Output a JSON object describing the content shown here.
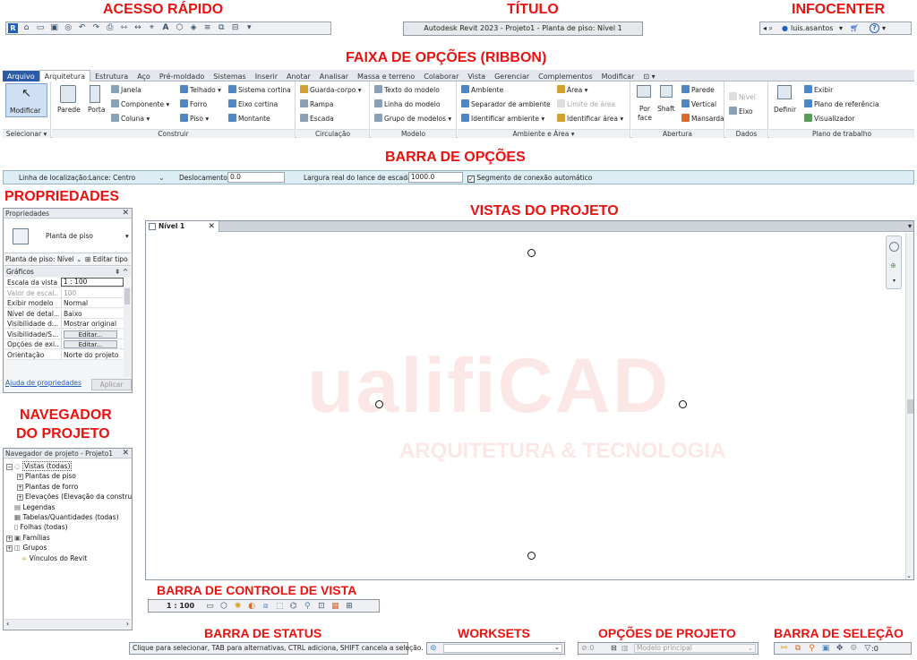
{
  "annotations": {
    "quick_access": "ACESSO RÁPIDO",
    "title": "TÍTULO",
    "infocenter": "INFOCENTER",
    "ribbon": "FAIXA DE OPÇÕES (RIBBON)",
    "options_bar": "BARRA DE OPÇÕES",
    "properties": "PROPRIEDADES",
    "project_views": "VISTAS DO PROJETO",
    "navigator_line1": "NAVEGADOR",
    "navigator_line2": "DO PROJETO",
    "view_control_bar": "BARRA DE CONTROLE DE VISTA",
    "status_bar": "BARRA DE STATUS",
    "worksets": "WORKSETS",
    "project_options": "OPÇÕES DE PROJETO",
    "selection_bar": "BARRA DE SELEÇÃO"
  },
  "window_title": "Autodesk Revit 2023 - Projeto1 - Planta de piso: Nível 1",
  "infocenter": {
    "user": "luis.asantos",
    "help": "?"
  },
  "tabs": [
    "Arquivo",
    "Arquitetura",
    "Estrutura",
    "Aço",
    "Pré-moldado",
    "Sistemas",
    "Inserir",
    "Anotar",
    "Analisar",
    "Massa e terreno",
    "Colaborar",
    "Vista",
    "Gerenciar",
    "Complementos",
    "Modificar"
  ],
  "ribbon": {
    "select": {
      "modify": "Modificar",
      "title": "Selecionar ▾"
    },
    "build": {
      "wall": "Parede",
      "door": "Porta",
      "window": "Janela",
      "component": "Componente",
      "column": "Coluna",
      "roof": "Telhado",
      "ceiling": "Forro",
      "floor": "Piso",
      "curtain_system": "Sistema cortina",
      "curtain_grid": "Eixo cortina",
      "mullion": "Montante",
      "title": "Construir"
    },
    "circulation": {
      "railing": "Guarda-corpo",
      "ramp": "Rampa",
      "stair": "Escada",
      "title": "Circulação"
    },
    "model": {
      "model_text": "Texto do modelo",
      "model_line": "Linha do modelo",
      "model_group": "Grupo de modelos",
      "title": "Modelo"
    },
    "room_area": {
      "room": "Ambiente",
      "room_separator": "Separador de ambiente",
      "tag_room": "Identificar ambiente",
      "area": "Área",
      "area_boundary": "Limite de área",
      "tag_area": "Identificar área",
      "title": "Ambiente e Área ▾"
    },
    "opening": {
      "by_face_1": "Por",
      "by_face_2": "face",
      "shaft": "Shaft",
      "wall": "Parede",
      "vertical": "Vertical",
      "dormer": "Mansarda",
      "title": "Abertura"
    },
    "datum": {
      "level": "Nível",
      "grid": "Eixo",
      "title": "Dados"
    },
    "work_plane": {
      "set": "Definir",
      "show": "Exibir",
      "ref_plane": "Plano de referência",
      "viewer": "Visualizador",
      "title": "Plano de trabalho"
    }
  },
  "options_bar": {
    "location_label": "Linha de localização:",
    "location_value": "Lance: Centro",
    "offset_label": "Deslocamento:",
    "offset_value": "0.0",
    "width_label": "Largura real do lance de escada:",
    "width_value": "1000.0",
    "auto_landing": "Segmento de conexão automático"
  },
  "properties": {
    "header": "Propriedades",
    "type_name": "Planta de piso",
    "instance": "Planta de piso: Nível",
    "edit_type": "Editar tipo",
    "group": "Gráficos",
    "rows": [
      {
        "k": "Escala da vista",
        "v": "1 : 100"
      },
      {
        "k": "Valor de escal...",
        "v": "100"
      },
      {
        "k": "Exibir modelo",
        "v": "Normal"
      },
      {
        "k": "Nível de detal...",
        "v": "Baixo"
      },
      {
        "k": "Visibilidade d...",
        "v": "Mostrar original"
      },
      {
        "k": "Visibilidade/S...",
        "v": "Editar..."
      },
      {
        "k": "Opções de exi...",
        "v": "Editar..."
      },
      {
        "k": "Orientação",
        "v": "Norte do projeto"
      }
    ],
    "help_link": "Ajuda de propriedades",
    "apply": "Aplicar"
  },
  "navigator": {
    "header": "Navegador de projeto - Projeto1",
    "items": [
      "Vistas (todas)",
      "Plantas de piso",
      "Plantas de forro",
      "Elevações (Elevação da constru",
      "Legendas",
      "Tabelas/Quantidades (todas)",
      "Folhas (todas)",
      "Famílias",
      "Grupos",
      "Vínculos do Revit"
    ]
  },
  "view": {
    "tab": "Nível 1",
    "watermark_main": "ualifiCAD",
    "watermark_sub": "ARQUITETURA & TECNOLOGIA"
  },
  "view_control": {
    "scale": "1 : 100"
  },
  "status": {
    "text": "Clique para selecionar, TAB para alternativas, CTRL adiciona, SHIFT cancela a seleção."
  },
  "design_options": {
    "value": "Modelo principal"
  },
  "selection": {
    "count": ":0"
  }
}
